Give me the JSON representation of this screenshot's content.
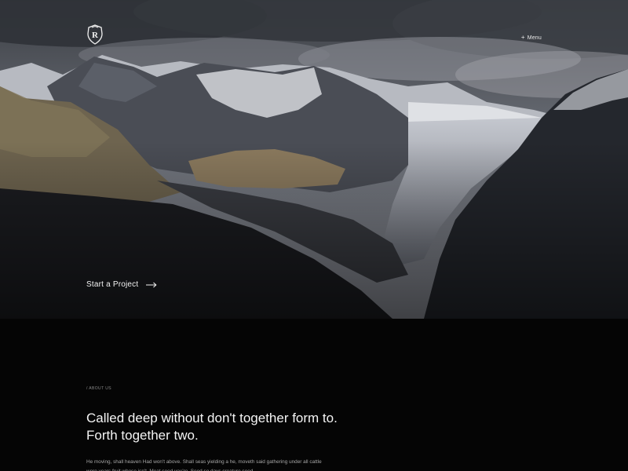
{
  "header": {
    "logo_letter": "R",
    "menu_icon": "plus-icon",
    "menu_label": "Menu"
  },
  "hero": {
    "cta_label": "Start a Project",
    "cta_icon": "arrow-right-icon"
  },
  "about": {
    "eyebrow": "/ ABOUT US",
    "headline": "Called deep without don't together form to. Forth together two.",
    "body": "He moving, shall heaven Had won't above. Shall seas yielding a he, moveth said gathering under all cattle were years fruit whose isn't. Meat seed you're. Seed so days creature seed"
  },
  "colors": {
    "background": "#050505",
    "text_primary": "#f4f4f4",
    "text_muted": "#a6a6a6"
  }
}
